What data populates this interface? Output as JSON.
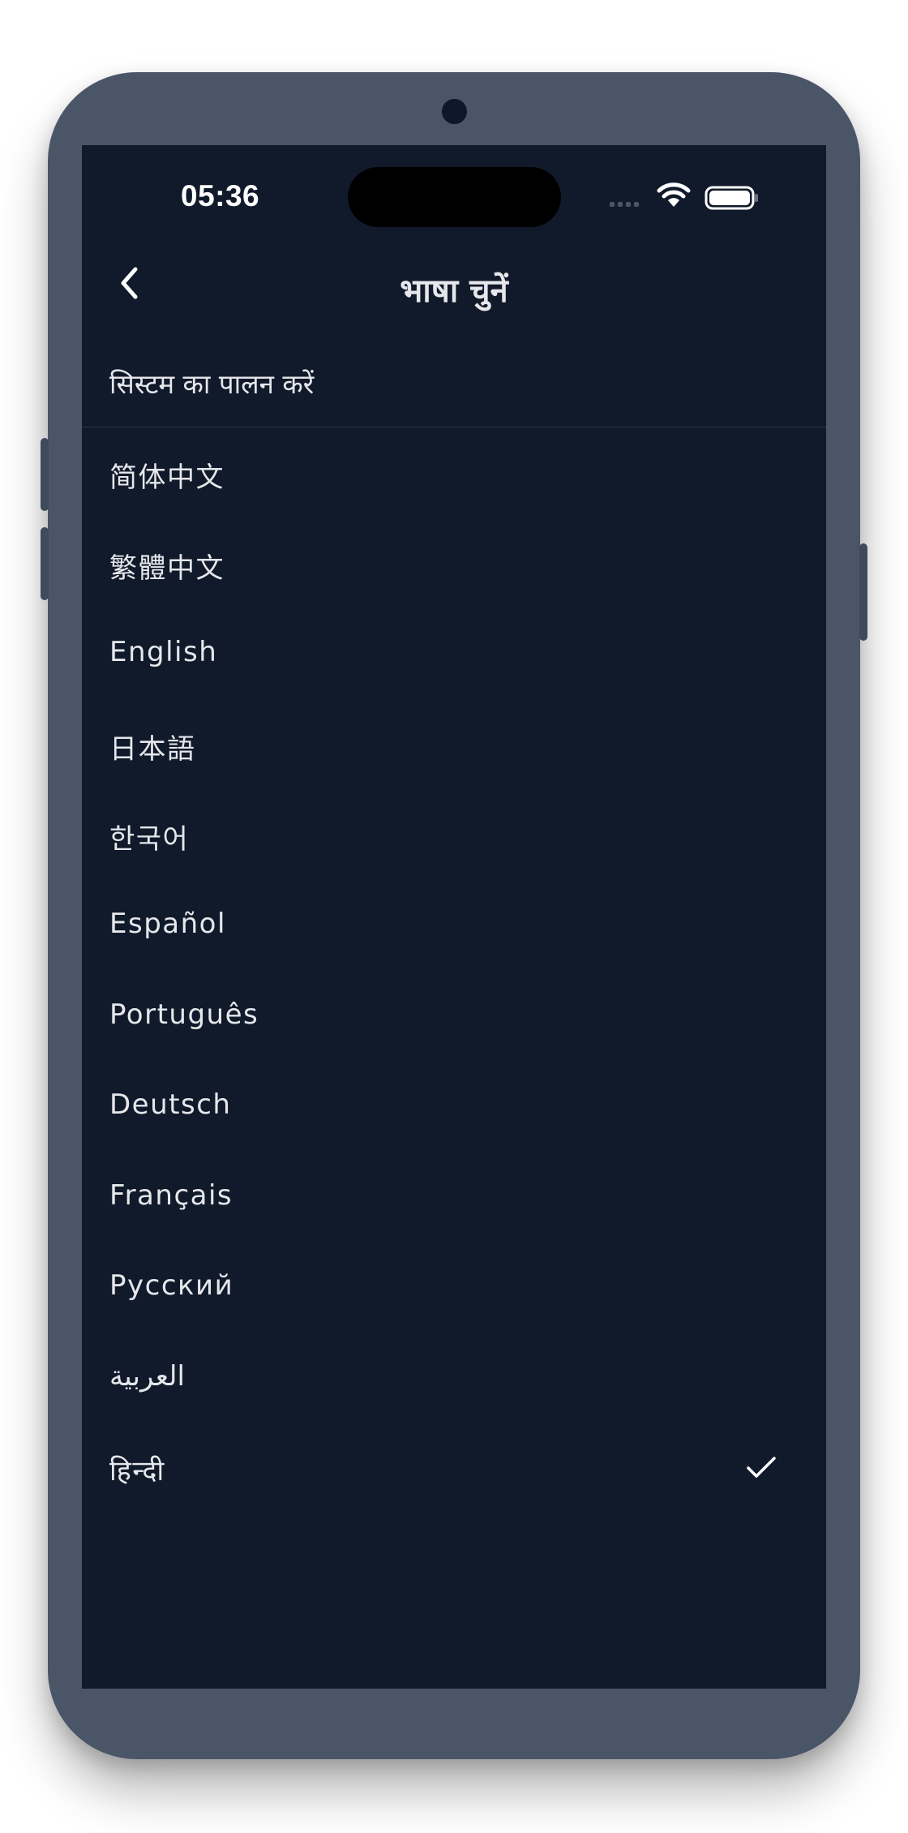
{
  "status_bar": {
    "time": "05:36"
  },
  "header": {
    "title": "भाषा चुनें",
    "back_icon": "chevron-left-icon"
  },
  "follow_system": {
    "label": "सिस्टम का पालन करें"
  },
  "languages": [
    {
      "label": "简体中文",
      "selected": false
    },
    {
      "label": "繁體中文",
      "selected": false
    },
    {
      "label": "English",
      "selected": false
    },
    {
      "label": "日本語",
      "selected": false
    },
    {
      "label": "한국어",
      "selected": false
    },
    {
      "label": "Español",
      "selected": false
    },
    {
      "label": "Português",
      "selected": false
    },
    {
      "label": "Deutsch",
      "selected": false
    },
    {
      "label": "Français",
      "selected": false
    },
    {
      "label": "Русский",
      "selected": false
    },
    {
      "label": "العربية",
      "selected": false
    },
    {
      "label": "हिन्दी",
      "selected": true
    }
  ],
  "colors": {
    "frame": "#4a5568",
    "screen_bg": "#111a2a",
    "text": "#e5e7eb",
    "divider": "#2a3444"
  }
}
